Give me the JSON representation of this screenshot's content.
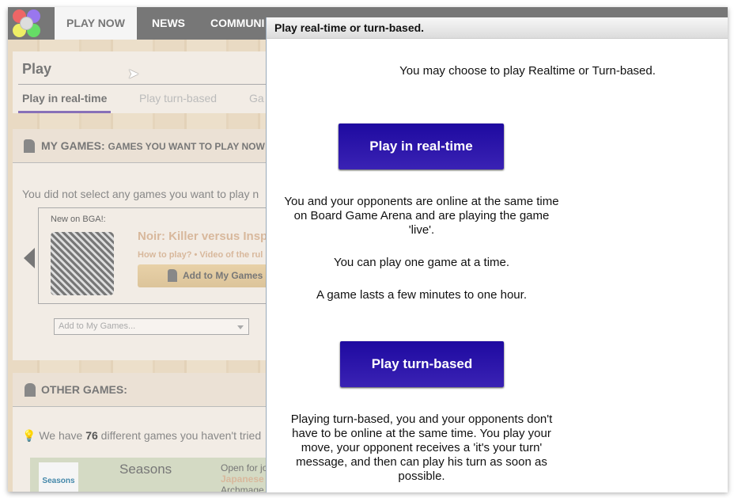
{
  "nav": {
    "tabs": [
      "PLAY NOW",
      "NEWS",
      "COMMUNI"
    ]
  },
  "play": {
    "title": "Play",
    "tabs": [
      "Play in real-time",
      "Play turn-based",
      "Ga"
    ]
  },
  "my_games": {
    "title": "MY GAMES:",
    "subtitle": "GAMES YOU WANT TO PLAY NOW",
    "empty": "You did not select any games you want to play n",
    "new_label": "New on BGA!:",
    "game_title": "Noir: Killer versus Inspe",
    "links": "How to play? • Video of the rul",
    "add_button": "Add to My Games",
    "select_placeholder": "Add to My Games..."
  },
  "other_games": {
    "title": "OTHER GAMES:",
    "count_prefix": "We have ",
    "count": "76",
    "count_suffix": " different games you haven't tried",
    "game": "Seasons",
    "logo_text": "Seasons",
    "status": "Open for joi",
    "line2": "Japanese s",
    "line3": "Archmage L"
  },
  "modal": {
    "title": "Play real-time or turn-based.",
    "intro": "You may choose to play Realtime or Turn-based.",
    "realtime_button": "Play in real-time",
    "realtime_desc": "You and your opponents are online at the same time on Board Game Arena and are playing the game 'live'.",
    "realtime_one": "You can play one game at a time.",
    "realtime_duration": "A game lasts a few minutes to one hour.",
    "turn_button": "Play turn-based",
    "turn_desc": "Playing turn-based, you and your opponents don't have to be online at the same time. You play your move, your opponent receives a 'it's your turn' message, and then can play his turn as soon as possible."
  }
}
